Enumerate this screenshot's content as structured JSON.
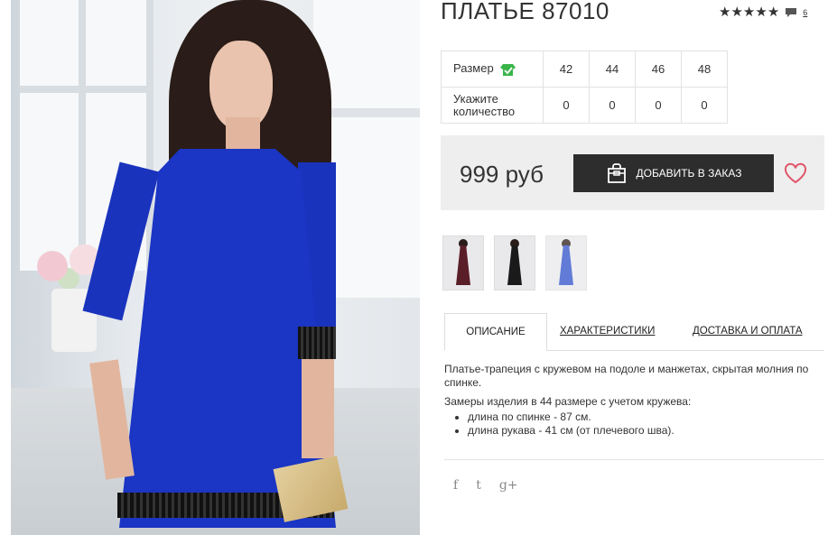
{
  "product": {
    "title": "ПЛАТЬЕ 87010",
    "review_count": "6",
    "rating_stars": 5
  },
  "sizes_table": {
    "size_label": "Размер",
    "qty_label_line1": "Укажите",
    "qty_label_line2": "количество",
    "sizes": [
      "42",
      "44",
      "46",
      "48"
    ],
    "quantities": [
      "0",
      "0",
      "0",
      "0"
    ]
  },
  "buy": {
    "price": "999 руб",
    "add_button_label": "ДОБАВИТЬ В ЗАКАЗ"
  },
  "tabs": {
    "description": "ОПИСАНИЕ",
    "characteristics": "ХАРАКТЕРИСТИКИ",
    "delivery": "ДОСТАВКА И ОПЛАТА"
  },
  "description": {
    "para1": "Платье-трапеция с кружевом на подоле и манжетах, скрытая молния по спинке.",
    "para2": "Замеры изделия в 44 размере с учетом кружева:",
    "bullet1": "длина по спинке - 87 см.",
    "bullet2": "длина рукава - 41 см (от плечевого шва)."
  },
  "social": {
    "facebook": "f",
    "twitter": "t",
    "googleplus": "g+"
  },
  "colors": {
    "dress_blue": "#1b35c4",
    "button_dark": "#2d2d2d",
    "heart": "#e0576b",
    "check_green": "#3ab54a"
  },
  "thumbnails": [
    {
      "name": "burgundy-dress",
      "color": "#5a1e28"
    },
    {
      "name": "black-dress",
      "color": "#1a1a1a"
    },
    {
      "name": "blue-dress",
      "color": "#2d4fc9"
    }
  ]
}
